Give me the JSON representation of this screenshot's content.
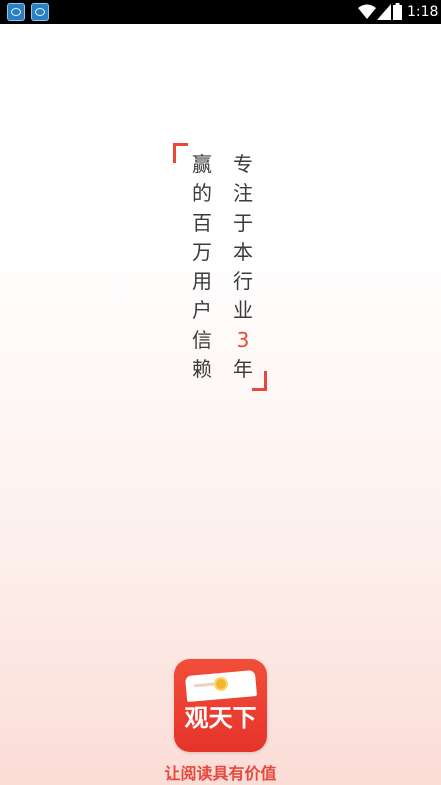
{
  "status_bar": {
    "time": "1:18",
    "notifications": [
      "app-notification-icon",
      "app-notification-icon"
    ],
    "icons": [
      "wifi-icon",
      "cellular-signal-icon",
      "battery-icon"
    ]
  },
  "slogan": {
    "left_column": [
      "赢",
      "的",
      "百",
      "万",
      "用",
      "户",
      "信",
      "赖"
    ],
    "right_column": [
      "专",
      "注",
      "于",
      "本",
      "行",
      "业",
      "3",
      "年"
    ]
  },
  "logo": {
    "text": "观天下",
    "icon": "newspaper-coin-icon"
  },
  "tagline": "让阅读具有价值",
  "colors": {
    "accent": "#e8483c",
    "logo_bg": "#e6332a",
    "text": "#3b3b3b",
    "status_bar": "#000000"
  }
}
